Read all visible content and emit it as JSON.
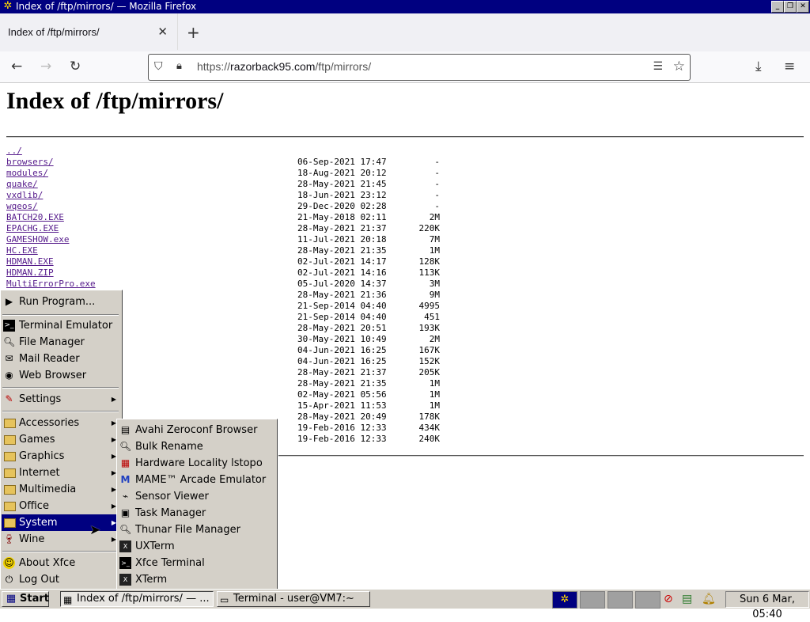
{
  "window": {
    "title": "Index of /ftp/mirrors/ — Mozilla Firefox",
    "app_icon": "xfce-mouse-icon"
  },
  "browser": {
    "tab_title": "Index of /ftp/mirrors/",
    "url_domain": "razorback95.com",
    "url_prefix": "https://",
    "url_path": "/ftp/mirrors/"
  },
  "page": {
    "heading": "Index of /ftp/mirrors/",
    "files": [
      {
        "name": "../",
        "date": "",
        "size": ""
      },
      {
        "name": "browsers/",
        "date": "06-Sep-2021 17:47",
        "size": "-"
      },
      {
        "name": "modules/",
        "date": "18-Aug-2021 20:12",
        "size": "-"
      },
      {
        "name": "quake/",
        "date": "28-May-2021 21:45",
        "size": "-"
      },
      {
        "name": "vxdlib/",
        "date": "18-Jun-2021 23:12",
        "size": "-"
      },
      {
        "name": "wqeos/",
        "date": "29-Dec-2020 02:28",
        "size": "-"
      },
      {
        "name": "BATCH20.EXE",
        "date": "21-May-2018 02:11",
        "size": "2M"
      },
      {
        "name": "EPACHG.EXE",
        "date": "28-May-2021 21:37",
        "size": "220K"
      },
      {
        "name": "GAMESHOW.exe",
        "date": "11-Jul-2021 20:18",
        "size": "7M"
      },
      {
        "name": "HC.EXE",
        "date": "28-May-2021 21:35",
        "size": "1M"
      },
      {
        "name": "HDMAN.EXE",
        "date": "02-Jul-2021 14:17",
        "size": "128K"
      },
      {
        "name": "HDMAN.ZIP",
        "date": "02-Jul-2021 14:16",
        "size": "113K"
      },
      {
        "name": "MultiErrorPro.exe",
        "date": "05-Jul-2020 14:37",
        "size": "3M"
      },
      {
        "name": "",
        "date": "28-May-2021 21:36",
        "size": "9M"
      },
      {
        "name": "",
        "date": "21-Sep-2014 04:40",
        "size": "4995"
      },
      {
        "name": "",
        "date": "21-Sep-2014 04:40",
        "size": "451"
      },
      {
        "name": "",
        "date": "28-May-2021 20:51",
        "size": "193K"
      },
      {
        "name": "",
        "date": "30-May-2021 10:49",
        "size": "2M"
      },
      {
        "name": "",
        "date": "04-Jun-2021 16:25",
        "size": "167K"
      },
      {
        "name": "",
        "date": "04-Jun-2021 16:25",
        "size": "152K"
      },
      {
        "name": "",
        "date": "28-May-2021 21:37",
        "size": "205K"
      },
      {
        "name": "",
        "date": "28-May-2021 21:35",
        "size": "1M"
      },
      {
        "name": "",
        "date": "02-May-2021 05:56",
        "size": "1M"
      },
      {
        "name": "",
        "date": "15-Apr-2021 11:53",
        "size": "1M"
      },
      {
        "name": "",
        "date": "28-May-2021 20:49",
        "size": "178K"
      },
      {
        "name": "",
        "date": "19-Feb-2016 12:33",
        "size": "434K"
      },
      {
        "name": "",
        "date": "19-Feb-2016 12:33",
        "size": "240K"
      }
    ]
  },
  "start_menu": {
    "run": "Run Program...",
    "terminal": "Terminal Emulator",
    "file_manager": "File Manager",
    "mail": "Mail Reader",
    "web": "Web Browser",
    "settings": "Settings",
    "accessories": "Accessories",
    "games": "Games",
    "graphics": "Graphics",
    "internet": "Internet",
    "multimedia": "Multimedia",
    "office": "Office",
    "system": "System",
    "wine": "Wine",
    "about": "About Xfce",
    "logout": "Log Out"
  },
  "system_menu": {
    "items": [
      "Avahi Zeroconf Browser",
      "Bulk Rename",
      "Hardware Locality lstopo",
      "MAME™ Arcade Emulator",
      "Sensor Viewer",
      "Task Manager",
      "Thunar File Manager",
      "UXTerm",
      "Xfce Terminal",
      "XTerm"
    ]
  },
  "taskbar": {
    "start": "Start",
    "task1": "Index of /ftp/mirrors/ — ...",
    "task2": "Terminal - user@VM7:~",
    "clock": "Sun  6 Mar, 05:40"
  }
}
